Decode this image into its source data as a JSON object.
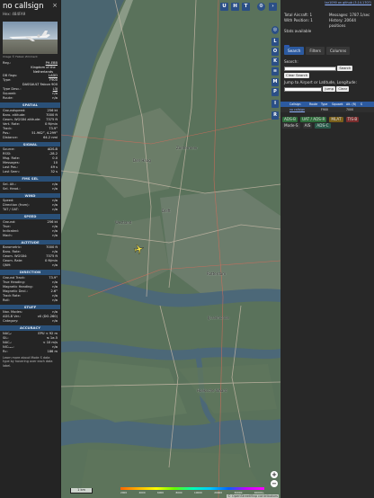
{
  "detail": {
    "callsign": "no callsign",
    "hex_label": "Hex: 484FA9",
    "close": "×",
    "photo_credit": "Image © Fabian Zimmerli",
    "reg_label": "Reg.:",
    "reg_value": "PH-EBB",
    "country": "Kingdom of the Netherlands",
    "db_flags_label": "DB flags:",
    "db_flags_value": "LADD",
    "type_label": "Type:",
    "type_value": "F900",
    "type_full": "DASSAULT Falcon 900",
    "type_desc_label": "Type Desc.:",
    "type_desc_value": "L3J",
    "squawk_label": "Squawk:",
    "squawk_value": "n/a",
    "route_label": "Route:",
    "route_value": "n/a",
    "sections": [
      {
        "title": "SPATIAL",
        "rows": [
          [
            "Groundspeed:",
            "256 kt"
          ],
          [
            "Baro. altitude:",
            "7000 ft"
          ],
          [
            "Geom. WGS84 altitude:",
            "7375 ft"
          ],
          [
            "Vert. Rate:",
            "0 ft/min"
          ],
          [
            "Track:",
            "73.9°"
          ],
          [
            "Pos.:",
            "51.962°, 4.299°"
          ],
          [
            "Distance:",
            "64.2 nmi"
          ]
        ]
      },
      {
        "title": "SIGNAL",
        "rows": [
          [
            "Source:",
            "ADS-B"
          ],
          [
            "RSSI:",
            "-28.2"
          ],
          [
            "Msg. Rate:",
            "0.0"
          ],
          [
            "Messages:",
            "10"
          ],
          [
            "Last Pos.:",
            "49 s"
          ],
          [
            "Last Seen:",
            "32 s"
          ]
        ]
      },
      {
        "title": "FMS SEL",
        "rows": [
          [
            "Sel. Alt.:",
            "n/a"
          ],
          [
            "Sel. Head.:",
            "n/a"
          ]
        ]
      },
      {
        "title": "WIND",
        "rows": [
          [
            "Speed:",
            "n/a"
          ],
          [
            "Direction (from):",
            "n/a"
          ],
          [
            "TAT / OAT:",
            "n/a"
          ]
        ]
      },
      {
        "title": "SPEED",
        "rows": [
          [
            "Ground:",
            "256 kt"
          ],
          [
            "True:",
            "n/a"
          ],
          [
            "Indicated:",
            "n/a"
          ],
          [
            "Mach:",
            "n/a"
          ]
        ]
      },
      {
        "title": "ALTITUDE",
        "rows": [
          [
            "Barometric:",
            "7000 ft"
          ],
          [
            "Baro. Rate:",
            "n/a"
          ],
          [
            "Geom. WGS84:",
            "7375 ft"
          ],
          [
            "Geom. Rate:",
            "0 ft/min"
          ],
          [
            "QNH:",
            "n/a"
          ]
        ]
      },
      {
        "title": "DIRECTION",
        "rows": [
          [
            "Ground Track:",
            "73.9°"
          ],
          [
            "True Heading:",
            "n/a"
          ],
          [
            "Magnetic Heading:",
            "n/a"
          ],
          [
            "Magnetic Decl.:",
            "2.6°"
          ],
          [
            "Track Rate:",
            "n/a"
          ],
          [
            "Roll:",
            "n/a"
          ]
        ]
      },
      {
        "title": "STUFF",
        "rows": [
          [
            "Nav. Modes:",
            "n/a"
          ],
          [
            "ADS-B Ver.:",
            "v0 (DO-260)"
          ],
          [
            "Category:",
            "n/a"
          ]
        ]
      },
      {
        "title": "ACCURACY",
        "rows": [
          [
            "NACₚ:",
            "EPU < 92 m"
          ],
          [
            "SIL:",
            "≤ 1e-5"
          ],
          [
            "NACᵥ:",
            "< 10 m/s"
          ],
          [
            "NICₕₐᵣₒ:",
            "n/a"
          ],
          [
            "Rᴄ:",
            "186 m"
          ]
        ]
      }
    ],
    "footnote": "Learn more about Mode S data type by hovering over each data label."
  },
  "map": {
    "top_buttons": [
      "U",
      "H",
      "T"
    ],
    "side_buttons": [
      "L",
      "O",
      "K",
      "M",
      "P",
      "I",
      "R"
    ],
    "zoom_in": "+",
    "zoom_out": "−",
    "scale_label": "1 km",
    "altitude_ticks": [
      "2000",
      "4000",
      "6000",
      "8000",
      "10000",
      "20000",
      "30000",
      "40000+"
    ],
    "attribution": "© OpenStreetMap contributors",
    "cities": [
      "Den Haag",
      "Delft",
      "Rotterdam",
      "Hoeksche Waard",
      "IJsselmonde",
      "Zoetermeer",
      "Westland"
    ],
    "accent": "#2b4f86",
    "aircraft_color": "#f2e24a"
  },
  "panel": {
    "top_link": "tar1090 on github (3.14.1707)",
    "total_aircraft": "Total Aircraft: 1",
    "messages": "Messages: 1787.1/sec",
    "with_position": "With Position: 1",
    "history": "History: 20644 positions",
    "stats_available": "Stats available",
    "tabs": [
      "Search",
      "Filters",
      "Columns"
    ],
    "search_label": "Search:",
    "search_button": "Search",
    "clear_search": "Clear Search",
    "jump_label": "Jump to Airport or Latitude, Longitude:",
    "jump_button": "Jump",
    "clear_button": "Clear",
    "table_headers": [
      "",
      "Callsign",
      "Route",
      "Type",
      "Squawk",
      "Alt. (ft)",
      "S"
    ],
    "table_row": [
      "",
      "no callsign",
      "",
      "F900",
      "",
      "7000",
      ""
    ],
    "sources": [
      "ADS-B",
      "UAT / ADS-R",
      "MLAT",
      "TIS-B",
      "Mode-S",
      "AIS",
      "ADS-C"
    ],
    "source_colors": [
      "#2f6d3b",
      "#2f6d3b",
      "#7a5f1a",
      "#7a2d2d",
      "#333333",
      "#333333",
      "#2a5a4a"
    ]
  }
}
